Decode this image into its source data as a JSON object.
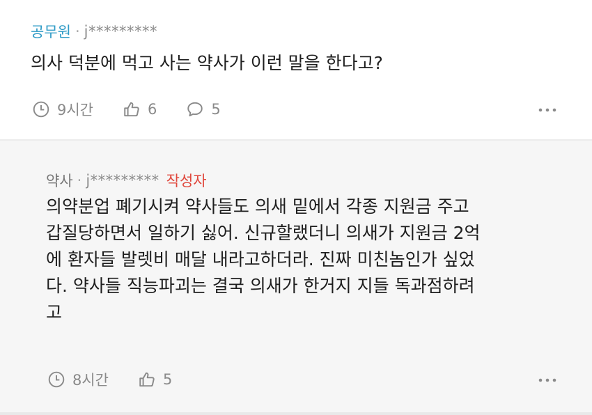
{
  "comment": {
    "author": "공무원",
    "user_id": "j*********",
    "text": "의사 덕분에 먹고 사는 약사가 이런 말을 한다고?",
    "time": "9시간",
    "likes": "6",
    "replies": "5"
  },
  "reply": {
    "author": "약사",
    "user_id": "j*********",
    "badge": "작성자",
    "lines": [
      "의약분업 폐기시켜 약사들도 의새 밑에서 각종 지원금 주고",
      "갑질당하면서 일하기 싫어. 신규할랬더니 의새가 지원금 2억",
      "에 환자들 발렛비 매달 내라고하더라. 진짜 미친놈인가 싶었",
      "다. 약사들 직능파괴는 결국 의새가 한거지 지들 독과점하려",
      "고"
    ],
    "time": "8시간",
    "likes": "5"
  },
  "colors": {
    "author_link": "#2f9bc6",
    "badge": "#e0473c",
    "meta_gray": "#8a8a8a",
    "reply_bg": "#f6f6f6"
  },
  "icons": [
    "clock-icon",
    "thumbs-up-icon",
    "speech-bubble-icon",
    "more-dots-icon"
  ]
}
